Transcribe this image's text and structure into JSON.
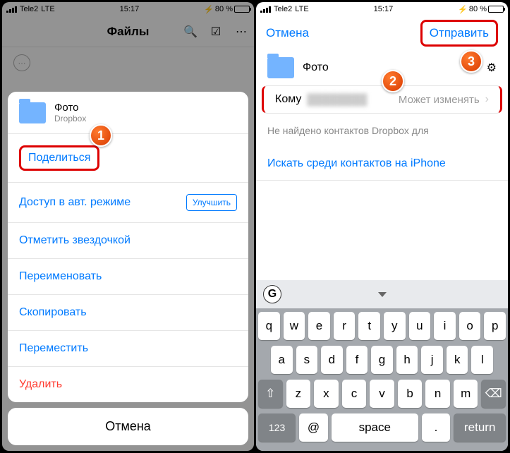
{
  "status": {
    "carrier": "Tele2",
    "net": "LTE",
    "time": "15:17",
    "battery": "80 %"
  },
  "left": {
    "title": "Файлы",
    "sheet": {
      "name": "Фото",
      "provider": "Dropbox",
      "share": "Поделиться",
      "auto": "Доступ в авт. режиме",
      "improve": "Улучшить",
      "star": "Отметить звездочкой",
      "rename": "Переименовать",
      "copy": "Скопировать",
      "move": "Переместить",
      "delete": "Удалить"
    },
    "cancel": "Отмена"
  },
  "right": {
    "cancel": "Отмена",
    "send": "Отправить",
    "folder": "Фото",
    "to": "Кому",
    "to_value": "████████",
    "perm": "Может изменять",
    "notfound": "Не найдено контактов Dropbox для",
    "search": "Искать среди контактов на iPhone",
    "g": "G",
    "keys_r1": [
      "q",
      "w",
      "e",
      "r",
      "t",
      "y",
      "u",
      "i",
      "o",
      "p"
    ],
    "keys_r2": [
      "a",
      "s",
      "d",
      "f",
      "g",
      "h",
      "j",
      "k",
      "l"
    ],
    "keys_r3": [
      "z",
      "x",
      "c",
      "v",
      "b",
      "n",
      "m"
    ],
    "k123": "123",
    "kspace": "space",
    "kreturn": "return",
    "kat": "@",
    "kdot": "."
  },
  "badges": {
    "b1": "1",
    "b2": "2",
    "b3": "3"
  }
}
